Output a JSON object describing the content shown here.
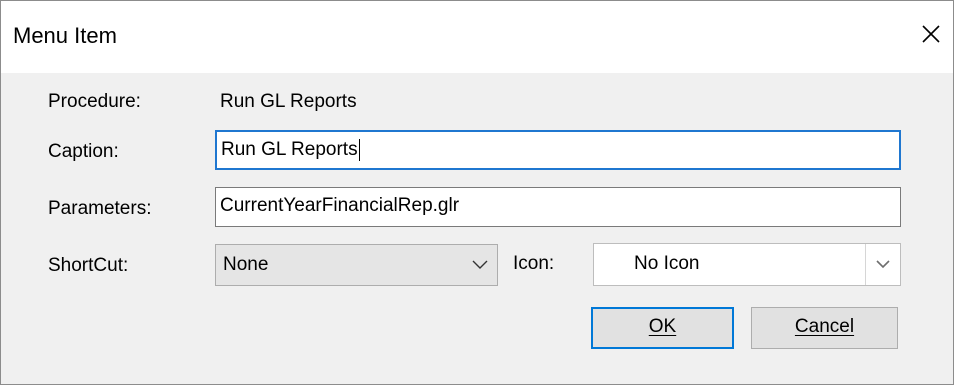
{
  "dialog": {
    "title": "Menu Item",
    "close_icon": "close-icon"
  },
  "form": {
    "procedure_label": "Procedure:",
    "procedure_value": "Run GL Reports",
    "caption_label": "Caption:",
    "caption_value": "Run GL Reports",
    "parameters_label": "Parameters:",
    "parameters_value": "CurrentYearFinancialRep.glr",
    "shortcut_label": "ShortCut:",
    "shortcut_value": "None",
    "icon_label": "Icon:",
    "icon_value": "No Icon"
  },
  "buttons": {
    "ok_label": "OK",
    "cancel_label": "Cancel"
  },
  "colors": {
    "accent": "#0078d7",
    "focus_border": "#1f77d0",
    "dialog_bg": "#f0f0f0"
  }
}
